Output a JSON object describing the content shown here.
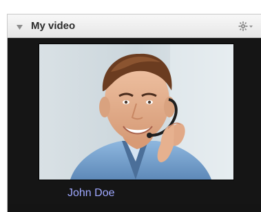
{
  "panel": {
    "title": "My video",
    "collapse_icon": "triangle-down-icon",
    "settings_icon": "gear-dropdown-icon"
  },
  "video": {
    "participant_name": "John Doe",
    "content": "video-feed"
  },
  "colors": {
    "panel_background": "#151515",
    "titlebar_background": "#ececec",
    "name_text": "#9fa8ff"
  }
}
